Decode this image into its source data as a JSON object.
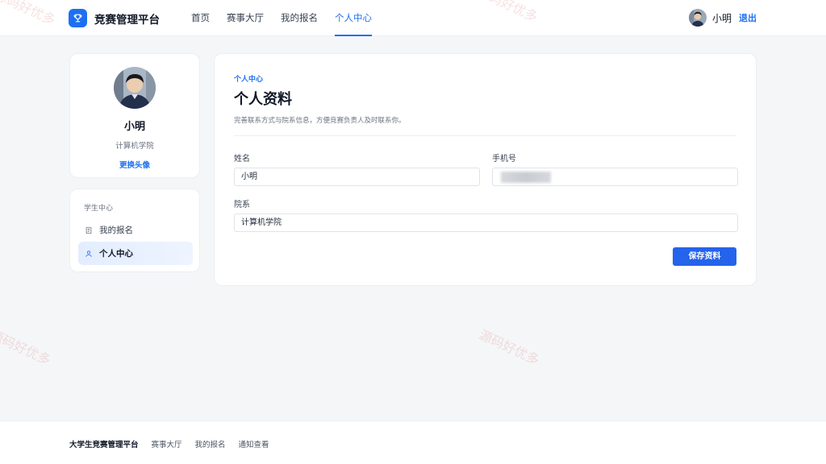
{
  "header": {
    "brand": "竞赛管理平台",
    "nav": [
      "首页",
      "赛事大厅",
      "我的报名",
      "个人中心"
    ],
    "active_nav": "个人中心",
    "user_name": "小明",
    "logout": "退出"
  },
  "sidebar": {
    "profile": {
      "name": "小明",
      "college": "计算机学院",
      "change_avatar": "更换头像"
    },
    "menu_title": "学生中心",
    "menu_items": [
      {
        "label": "我的报名",
        "icon": "document-icon",
        "active": false
      },
      {
        "label": "个人中心",
        "icon": "user-icon",
        "active": true
      }
    ]
  },
  "main": {
    "breadcrumb": "个人中心",
    "title": "个人资料",
    "description": "完善联系方式与院系信息，方便竞赛负责人及时联系你。",
    "fields": {
      "name": {
        "label": "姓名",
        "value": "小明"
      },
      "phone": {
        "label": "手机号",
        "value": ""
      },
      "department": {
        "label": "院系",
        "value": "计算机学院"
      }
    },
    "save_button": "保存资料"
  },
  "watermark": "源码好优多",
  "footer": {
    "brand": "大学生竞赛管理平台",
    "links": [
      "赛事大厅",
      "我的报名",
      "通知查看"
    ]
  },
  "colors": {
    "accent": "#1d6ff2",
    "button": "#2563eb",
    "background": "#f5f6f8"
  }
}
